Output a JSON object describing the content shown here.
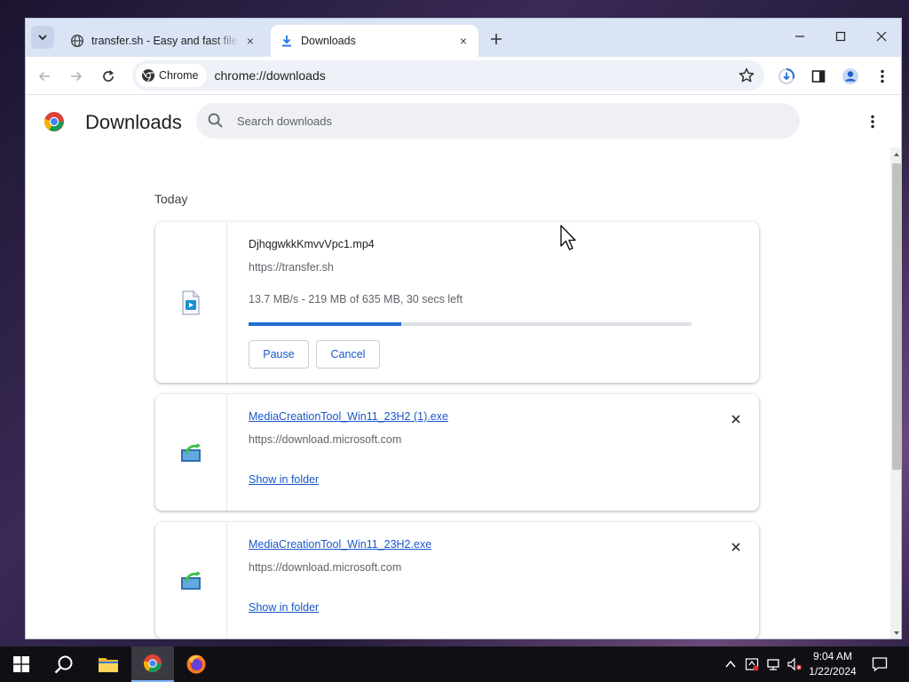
{
  "tabs": [
    {
      "title": "transfer.sh - Easy and fast file sharing from the command-line.",
      "close": "×"
    },
    {
      "title": "Downloads",
      "close": "×"
    }
  ],
  "toolbar": {
    "chip_label": "Chrome",
    "url": "chrome://downloads"
  },
  "page": {
    "title": "Downloads",
    "search_placeholder": "Search downloads",
    "section_label": "Today"
  },
  "downloads": [
    {
      "filename": "DjhqgwkkKmvvVpc1.mp4",
      "source": "https://transfer.sh",
      "status": "13.7 MB/s - 219 MB of 635 MB, 30 secs left",
      "progress": 0.345,
      "pause_label": "Pause",
      "cancel_label": "Cancel",
      "icon": "video-file-icon"
    },
    {
      "filename": "MediaCreationTool_Win11_23H2 (1).exe",
      "source": "https://download.microsoft.com",
      "action": "Show in folder",
      "icon": "installer-icon"
    },
    {
      "filename": "MediaCreationTool_Win11_23H2.exe",
      "source": "https://download.microsoft.com",
      "action": "Show in folder",
      "icon": "installer-icon"
    }
  ],
  "taskbar": {
    "time": "9:04 AM",
    "date": "1/22/2024"
  },
  "colors": {
    "accent": "#1f6fd0",
    "link": "#1a57c9",
    "tabstrip": "#dbe4f5",
    "taskbar": "#101014"
  }
}
